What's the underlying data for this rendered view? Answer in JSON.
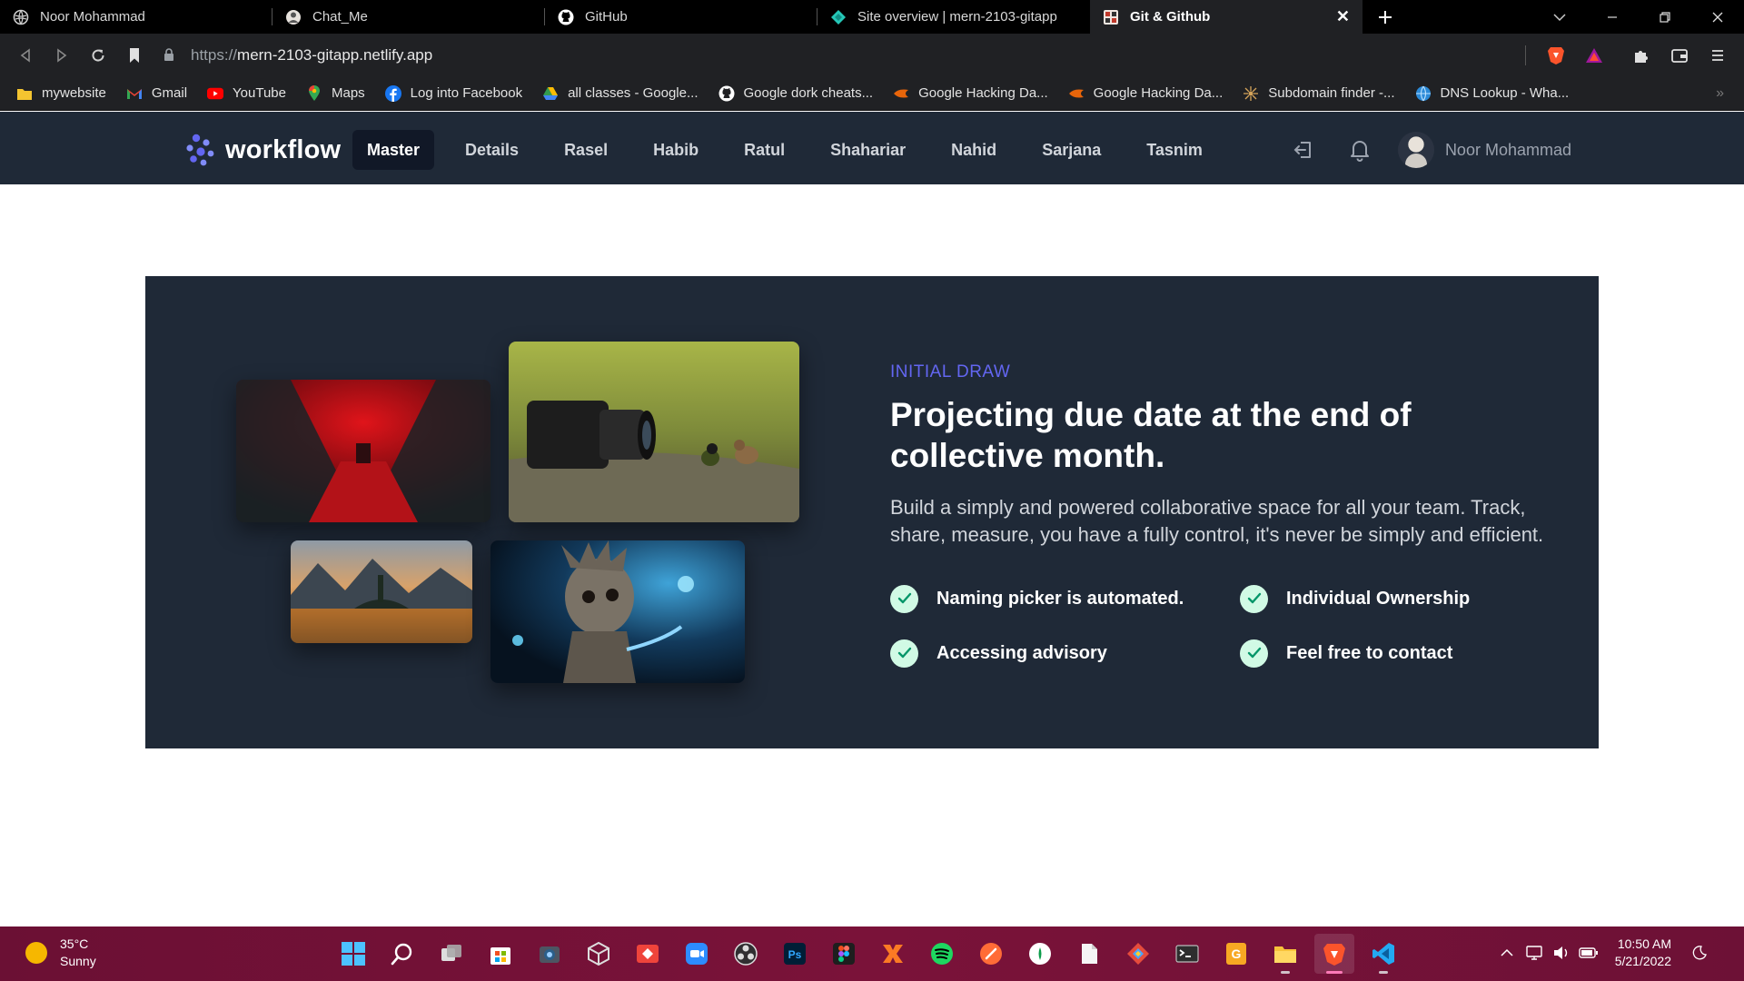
{
  "browser": {
    "tabs": [
      {
        "title": "Noor Mohammad",
        "icon": "globe-icon",
        "active": false
      },
      {
        "title": "Chat_Me",
        "icon": "chat-me-favicon-icon",
        "active": false
      },
      {
        "title": "GitHub",
        "icon": "github-icon",
        "active": false
      },
      {
        "title": "Site overview | mern-2103-gitapp",
        "icon": "netlify-icon",
        "active": false
      },
      {
        "title": "Git & Github",
        "icon": "git-github-favicon-icon",
        "active": true
      }
    ],
    "url_scheme": "https://",
    "url_host": "mern-2103-gitapp.netlify.app",
    "bookmarks": [
      {
        "label": "mywebsite",
        "icon": "folder-icon"
      },
      {
        "label": "Gmail",
        "icon": "gmail-icon"
      },
      {
        "label": "YouTube",
        "icon": "youtube-icon"
      },
      {
        "label": "Maps",
        "icon": "maps-icon"
      },
      {
        "label": "Log into Facebook",
        "icon": "facebook-icon"
      },
      {
        "label": "all classes - Google...",
        "icon": "google-drive-icon"
      },
      {
        "label": "Google dork cheats...",
        "icon": "github-icon"
      },
      {
        "label": "Google Hacking Da...",
        "icon": "exploit-db-icon"
      },
      {
        "label": "Google Hacking Da...",
        "icon": "exploit-db-icon"
      },
      {
        "label": "Subdomain finder -...",
        "icon": "subdomain-finder-icon"
      },
      {
        "label": "DNS Lookup - Wha...",
        "icon": "dns-lookup-icon"
      }
    ]
  },
  "site": {
    "brand": "workflow",
    "nav": [
      "Master",
      "Details",
      "Rasel",
      "Habib",
      "Ratul",
      "Shahariar",
      "Nahid",
      "Sarjana",
      "Tasnim"
    ],
    "active_nav": "Master",
    "user_name": "Noor Mohammad"
  },
  "hero": {
    "eyebrow": "INITIAL DRAW",
    "headline": "Projecting due date at the end of collective month.",
    "description": "Build a simply and powered collaborative space for all your team. Track, share, measure, you have a fully control, it's never be simply and efficient.",
    "features": [
      "Naming picker is automated.",
      "Individual Ownership",
      "Accessing advisory",
      "Feel free to contact"
    ],
    "accent_color": "#6366f1",
    "card_color": "#1f2937"
  },
  "taskbar": {
    "temperature": "35°C",
    "condition": "Sunny",
    "time": "10:50 AM",
    "date": "5/21/2022"
  }
}
